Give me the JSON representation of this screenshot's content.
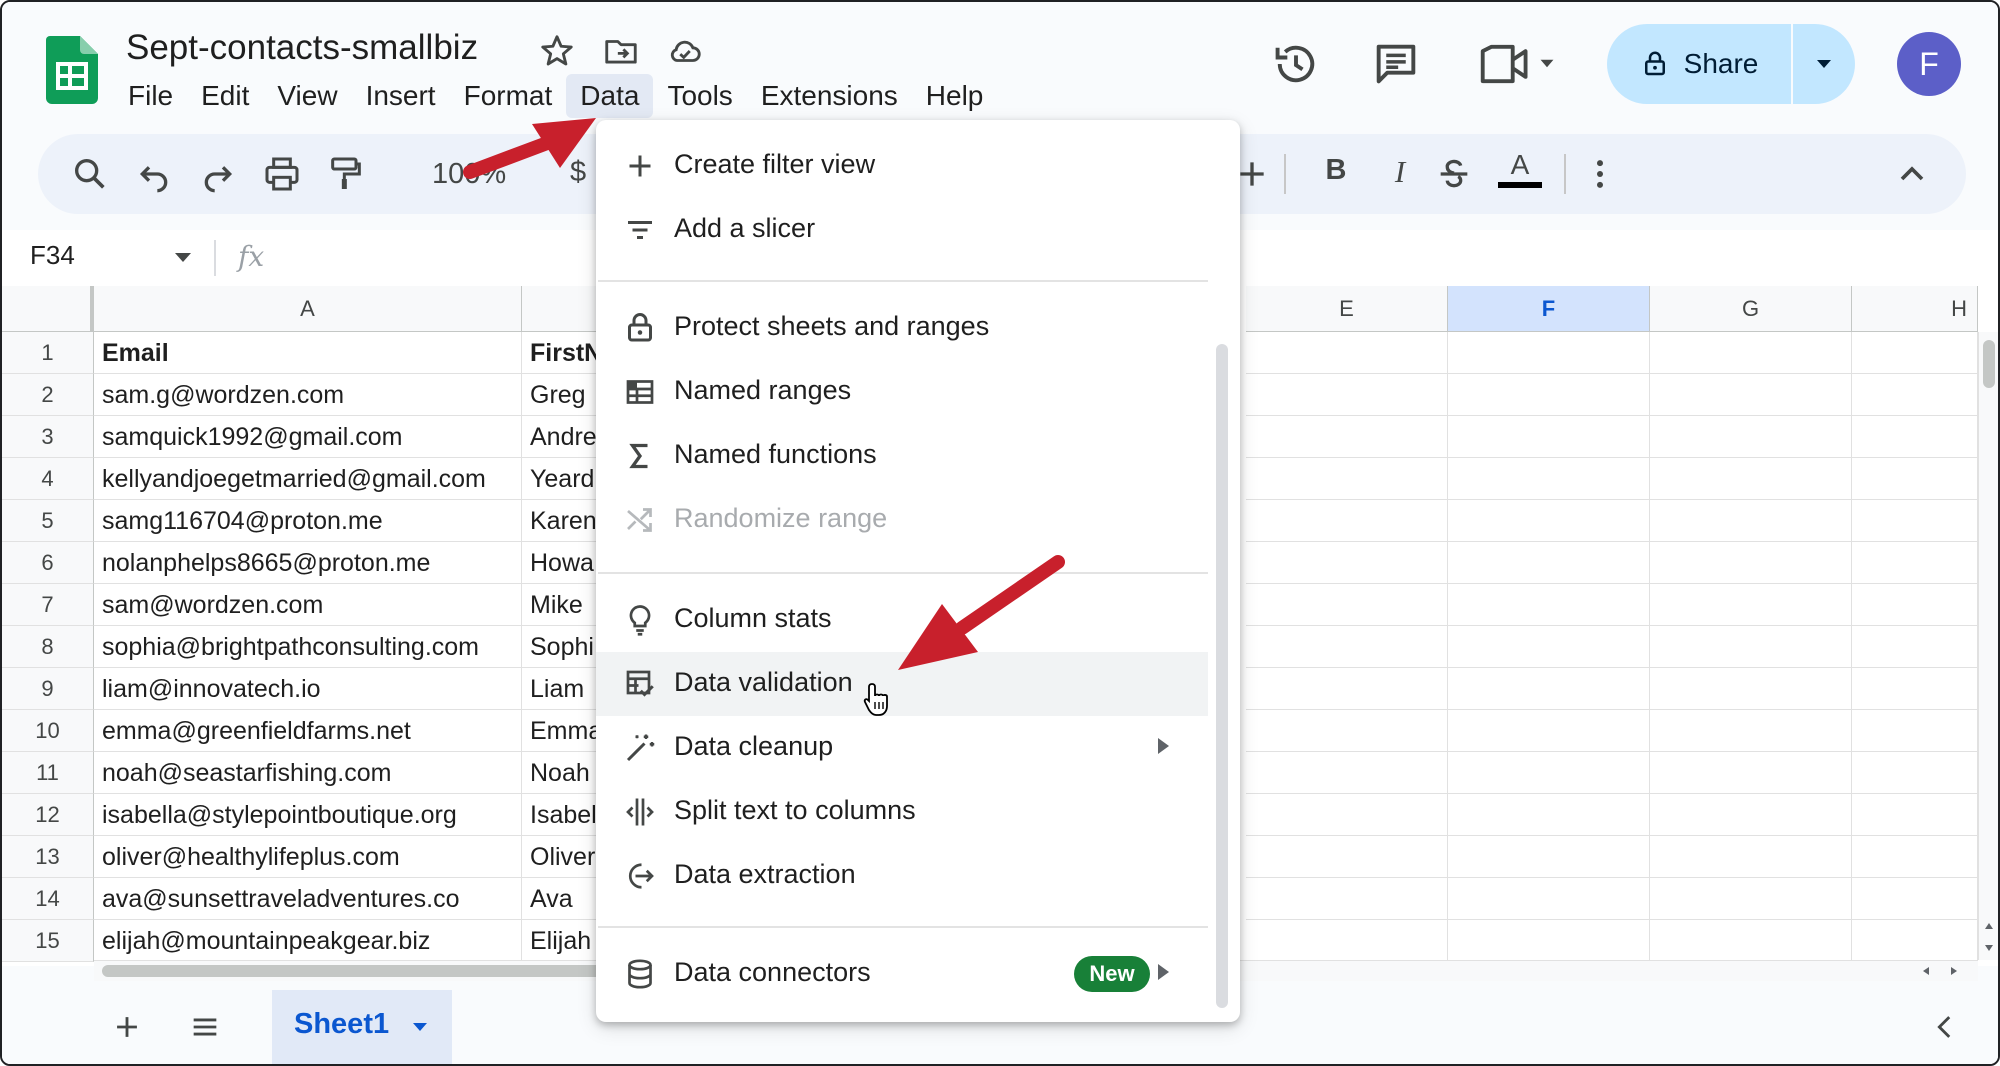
{
  "app": {
    "doc_title": "Sept-contacts-smallbiz",
    "menu": [
      "File",
      "Edit",
      "View",
      "Insert",
      "Format",
      "Data",
      "Tools",
      "Extensions",
      "Help"
    ],
    "active_menu": "Data",
    "share_label": "Share",
    "avatar_letter": "F",
    "accent_color": "#c2e7ff",
    "icons": [
      "star-icon",
      "move-to-folder-icon",
      "cloud-saved-icon",
      "version-history-icon",
      "comments-icon",
      "meet-icon",
      "lock-icon",
      "sheets-logo-icon"
    ]
  },
  "toolbar": {
    "zoom": "100%",
    "currency_symbol": "$",
    "bold": "B",
    "italic": "I",
    "text_color_letter": "A",
    "icons": [
      "search-icon",
      "undo-icon",
      "redo-icon",
      "print-icon",
      "paint-format-icon",
      "plus-icon",
      "bold-icon",
      "italic-icon",
      "strikethrough-icon",
      "text-color-icon",
      "more-icon",
      "collapse-icon"
    ]
  },
  "formula_bar": {
    "name_box": "F34",
    "fx": "fx"
  },
  "grid": {
    "columns": [
      "A",
      "E",
      "F",
      "G",
      "H"
    ],
    "selected_column": "F",
    "rows": [
      {
        "num": "1",
        "email": "Email",
        "first": "FirstN"
      },
      {
        "num": "2",
        "email": "sam.g@wordzen.com",
        "first": "Greg"
      },
      {
        "num": "3",
        "email": "samquick1992@gmail.com",
        "first": "Andre"
      },
      {
        "num": "4",
        "email": "kellyandjoegetmarried@gmail.com",
        "first": "Yeard"
      },
      {
        "num": "5",
        "email": "samg116704@proton.me",
        "first": "Karen"
      },
      {
        "num": "6",
        "email": "nolanphelps8665@proton.me",
        "first": "Howa"
      },
      {
        "num": "7",
        "email": "sam@wordzen.com",
        "first": "Mike"
      },
      {
        "num": "8",
        "email": "sophia@brightpathconsulting.com",
        "first": "Sophi"
      },
      {
        "num": "9",
        "email": "liam@innovatech.io",
        "first": "Liam"
      },
      {
        "num": "10",
        "email": "emma@greenfieldfarms.net",
        "first": "Emma"
      },
      {
        "num": "11",
        "email": "noah@seastarfishing.com",
        "first": "Noah"
      },
      {
        "num": "12",
        "email": "isabella@stylepointboutique.org",
        "first": "Isabel"
      },
      {
        "num": "13",
        "email": "oliver@healthylifeplus.com",
        "first": "Oliver"
      },
      {
        "num": "14",
        "email": "ava@sunsettraveladventures.co",
        "first": "Ava"
      },
      {
        "num": "15",
        "email": "elijah@mountainpeakgear.biz",
        "first": "Elijah"
      }
    ]
  },
  "sheet_tabs": {
    "active": "Sheet1"
  },
  "data_menu": {
    "items": [
      {
        "label": "Create filter view",
        "icon": "plus-icon"
      },
      {
        "label": "Add a slicer",
        "icon": "filter-lines-icon"
      },
      {
        "label": "Protect sheets and ranges",
        "icon": "lock-icon"
      },
      {
        "label": "Named ranges",
        "icon": "named-ranges-icon"
      },
      {
        "label": "Named functions",
        "icon": "sigma-icon"
      },
      {
        "label": "Randomize range",
        "icon": "shuffle-icon",
        "disabled": true
      },
      {
        "label": "Column stats",
        "icon": "lightbulb-icon"
      },
      {
        "label": "Data validation",
        "icon": "data-validation-icon",
        "hovered": true
      },
      {
        "label": "Data cleanup",
        "icon": "magic-wand-icon",
        "submenu": true
      },
      {
        "label": "Split text to columns",
        "icon": "split-columns-icon"
      },
      {
        "label": "Data extraction",
        "icon": "extract-icon"
      },
      {
        "label": "Data connectors",
        "icon": "database-icon",
        "badge": "New",
        "submenu": true
      }
    ],
    "badge_color": "#188038"
  },
  "annotations": {
    "arrow_color": "#c8202c"
  }
}
